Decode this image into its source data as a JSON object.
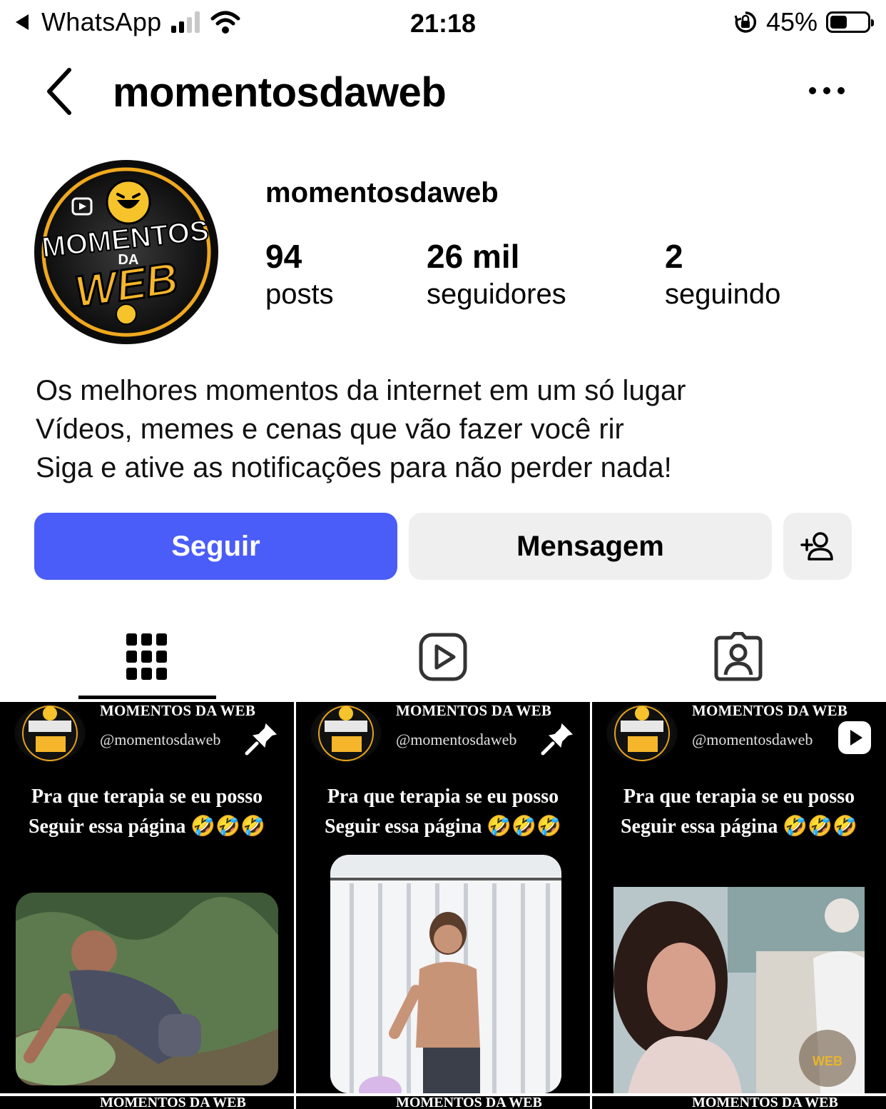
{
  "status_bar": {
    "back_app": "WhatsApp",
    "time": "21:18",
    "battery": "45%",
    "battery_level": 0.45
  },
  "header": {
    "title": "momentosdaweb",
    "back_icon": "chevron-left-icon",
    "more_icon": "more-horizontal-icon"
  },
  "profile": {
    "avatar_text": [
      "MOMENTOS",
      "DA",
      "WEB"
    ],
    "name": "momentosdaweb",
    "stats": [
      {
        "value": "94",
        "label": "posts"
      },
      {
        "value": "26 mil",
        "label": "seguidores"
      },
      {
        "value": "2",
        "label": "seguindo"
      }
    ],
    "bio": [
      "Os melhores momentos da internet em um só lugar",
      "Vídeos, memes e cenas que vão fazer você rir",
      "Siga e ative as notificações para não perder nada!"
    ]
  },
  "actions": {
    "follow_label": "Seguir",
    "message_label": "Mensagem",
    "suggest_icon": "add-person-icon",
    "follow_color": "#4a5df9"
  },
  "tabs": [
    {
      "icon": "grid-icon",
      "active": true
    },
    {
      "icon": "reels-icon",
      "active": false
    },
    {
      "icon": "tagged-icon",
      "active": false
    }
  ],
  "posts": [
    {
      "brand": "MOMENTOS DA WEB",
      "handle": "@momentosdaweb",
      "caption_line1": "Pra que terapia se eu posso",
      "caption_line2": "Seguir essa página 🤣🤣🤣",
      "badge_icon": "pin-icon"
    },
    {
      "brand": "MOMENTOS DA WEB",
      "handle": "@momentosdaweb",
      "caption_line1": "Pra que terapia se eu posso",
      "caption_line2": "Seguir essa página 🤣🤣🤣",
      "badge_icon": "pin-icon"
    },
    {
      "brand": "MOMENTOS DA WEB",
      "handle": "@momentosdaweb",
      "caption_line1": "Pra que terapia se eu posso",
      "caption_line2": "Seguir essa página 🤣🤣🤣",
      "badge_icon": "reel-play-icon"
    }
  ],
  "next_row_brand": "MOMENTOS DA WEB"
}
